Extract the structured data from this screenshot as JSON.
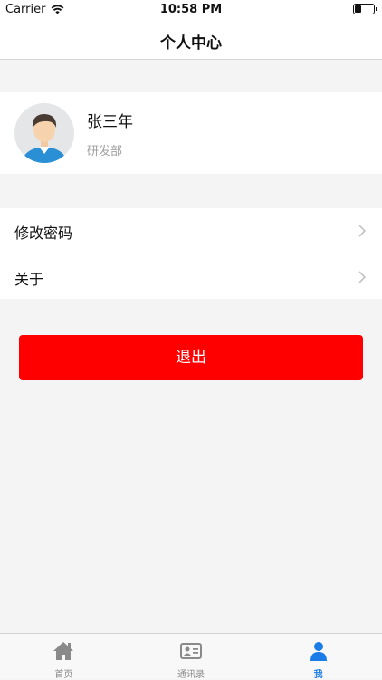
{
  "status_bar": {
    "carrier": "Carrier",
    "time": "10:58 PM"
  },
  "nav": {
    "title": "个人中心"
  },
  "profile": {
    "name": "张三年",
    "department": "研发部"
  },
  "menu": {
    "items": [
      {
        "label": "修改密码"
      },
      {
        "label": "关于"
      }
    ]
  },
  "logout": {
    "label": "退出"
  },
  "tab_bar": {
    "items": [
      {
        "label": "首页",
        "icon": "home-icon"
      },
      {
        "label": "通讯录",
        "icon": "contacts-icon"
      },
      {
        "label": "我",
        "icon": "person-icon",
        "active": true
      }
    ]
  },
  "colors": {
    "accent": "#1b7ce8",
    "logout": "#ff0000",
    "background": "#f4f4f4"
  }
}
